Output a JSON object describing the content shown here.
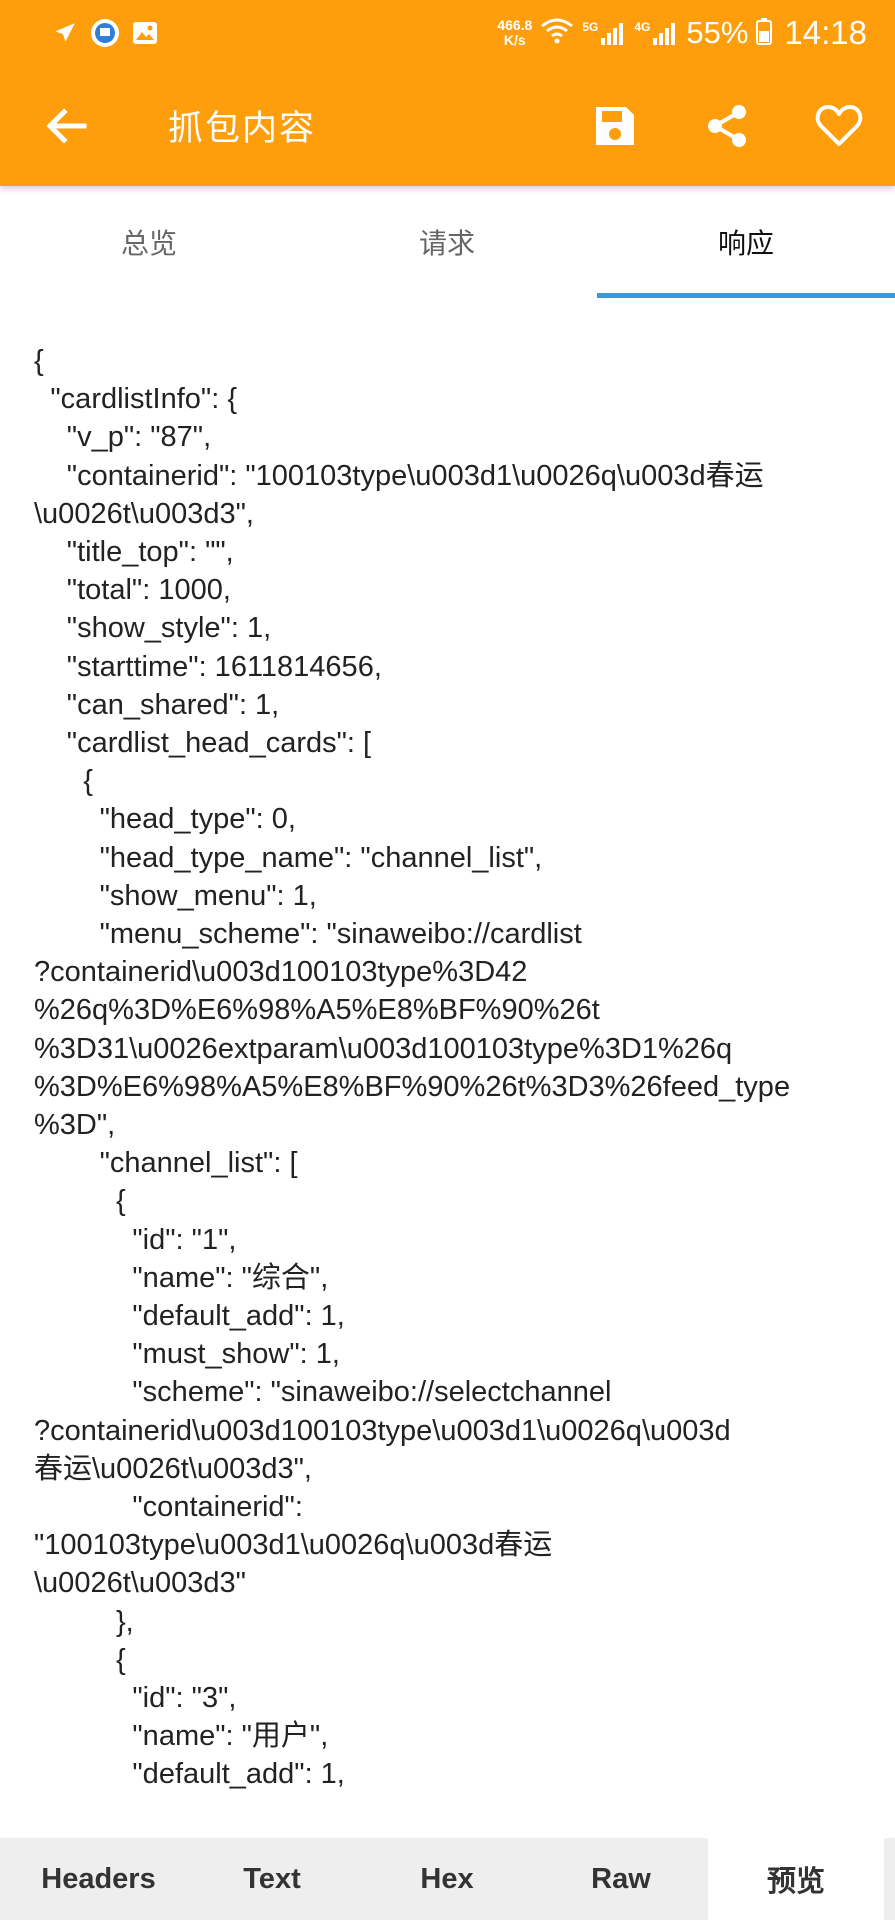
{
  "status_bar": {
    "left_icons": [
      "airplane-icon",
      "app-badge-icon",
      "image-icon"
    ],
    "net_speed_value": "466.8",
    "net_speed_unit": "K/s",
    "net_5g": "5G",
    "net_4g": "4G",
    "battery_percent": "55%",
    "time": "14:18"
  },
  "toolbar": {
    "title": "抓包内容",
    "back_icon": "arrow-left-icon",
    "actions": [
      "save-icon",
      "share-icon",
      "heart-icon"
    ]
  },
  "tabs": [
    {
      "label": "总览"
    },
    {
      "label": "请求"
    },
    {
      "label": "响应",
      "active": true
    }
  ],
  "response_lines": [
    "{",
    "  \"cardlistInfo\": {",
    "    \"v_p\": \"87\",",
    "    \"containerid\": \"100103type\\u003d1\\u0026q\\u003d春运",
    "\\u0026t\\u003d3\",",
    "    \"title_top\": \"\",",
    "    \"total\": 1000,",
    "    \"show_style\": 1,",
    "    \"starttime\": 1611814656,",
    "    \"can_shared\": 1,",
    "    \"cardlist_head_cards\": [",
    "      {",
    "        \"head_type\": 0,",
    "        \"head_type_name\": \"channel_list\",",
    "        \"show_menu\": 1,",
    "        \"menu_scheme\": \"sinaweibo://cardlist",
    "?containerid\\u003d100103type%3D42",
    "%26q%3D%E6%98%A5%E8%BF%90%26t",
    "%3D31\\u0026extparam\\u003d100103type%3D1%26q",
    "%3D%E6%98%A5%E8%BF%90%26t%3D3%26feed_type",
    "%3D\",",
    "        \"channel_list\": [",
    "          {",
    "            \"id\": \"1\",",
    "            \"name\": \"综合\",",
    "            \"default_add\": 1,",
    "            \"must_show\": 1,",
    "            \"scheme\": \"sinaweibo://selectchannel",
    "?containerid\\u003d100103type\\u003d1\\u0026q\\u003d",
    "春运\\u0026t\\u003d3\",",
    "            \"containerid\":",
    "\"100103type\\u003d1\\u0026q\\u003d春运",
    "\\u0026t\\u003d3\"",
    "          },",
    "          {",
    "            \"id\": \"3\",",
    "            \"name\": \"用户\",",
    "            \"default_add\": 1,"
  ],
  "bottom_tabs": [
    {
      "label": "Headers"
    },
    {
      "label": "Text"
    },
    {
      "label": "Hex"
    },
    {
      "label": "Raw"
    },
    {
      "label": "预览",
      "active": true
    }
  ],
  "colors": {
    "app_bar": "#ff9e0c",
    "tab_indicator": "#3a9ad9",
    "bottom_bar": "#eeeeee"
  }
}
